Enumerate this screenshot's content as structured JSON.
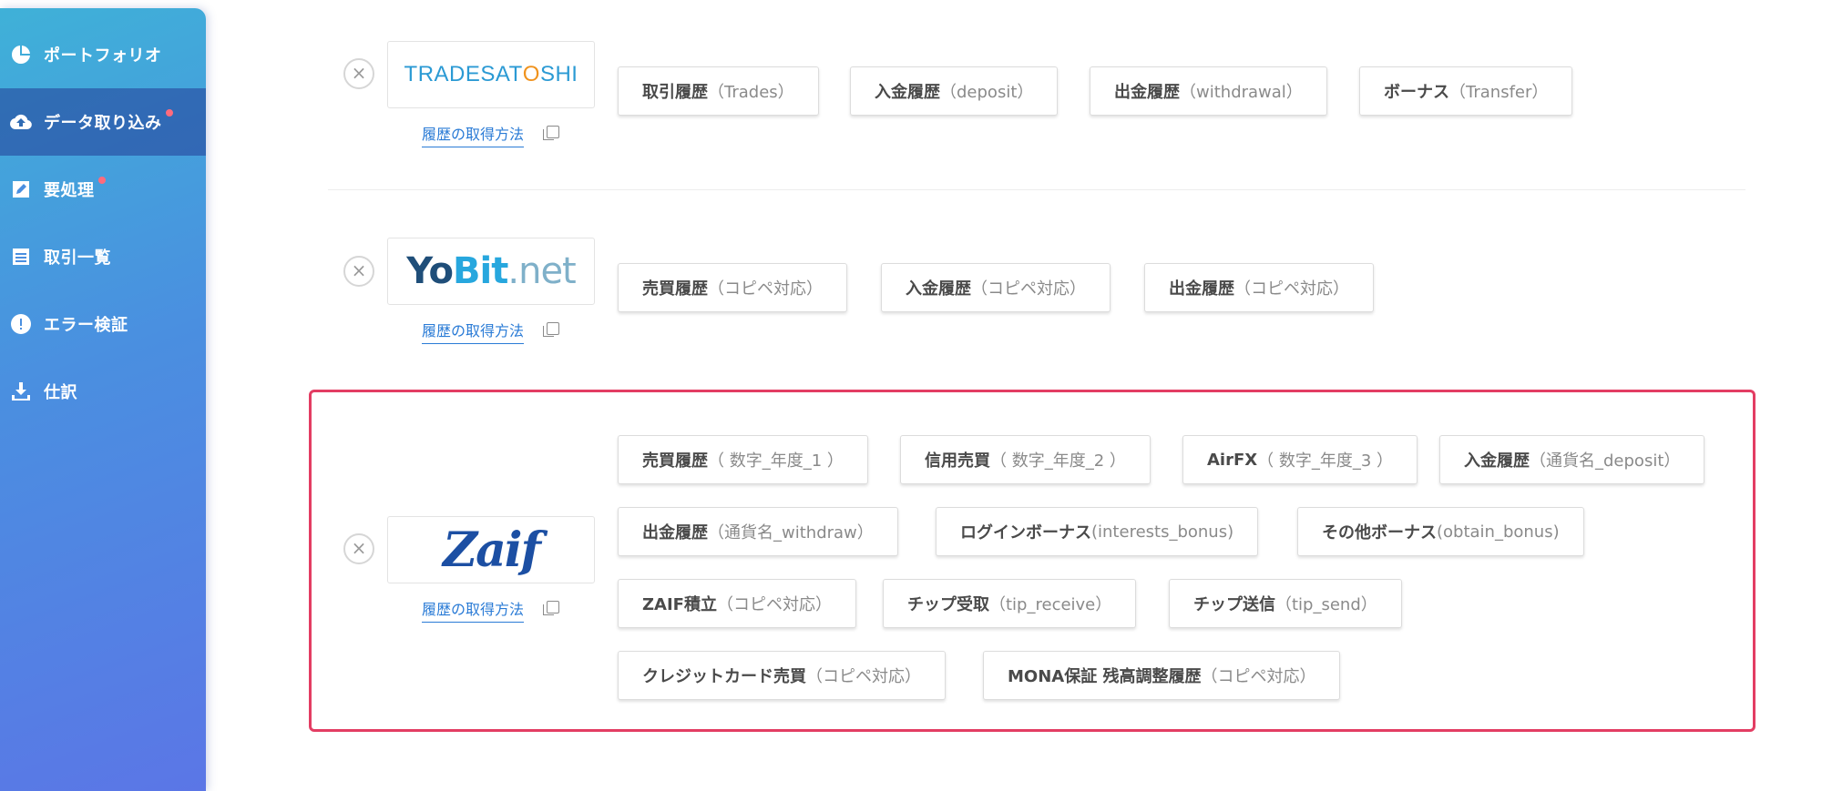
{
  "sidebar": {
    "items": [
      {
        "label": "ポートフォリオ",
        "icon": "pie-chart-icon",
        "active": false,
        "dot": false
      },
      {
        "label": "データ取り込み",
        "icon": "cloud-upload-icon",
        "active": true,
        "dot": true
      },
      {
        "label": "要処理",
        "icon": "edit-icon",
        "active": false,
        "dot": true
      },
      {
        "label": "取引一覧",
        "icon": "list-icon",
        "active": false,
        "dot": false
      },
      {
        "label": "エラー検証",
        "icon": "alert-icon",
        "active": false,
        "dot": false
      },
      {
        "label": "仕訳",
        "icon": "download-icon",
        "active": false,
        "dot": false
      }
    ],
    "dot_color": "#ff6b7d"
  },
  "howto_label": "履歴の取得方法",
  "remove_symbol": "×",
  "exchanges": [
    {
      "name": "tradesatoshi",
      "logo": {
        "part1": "TRADESAT",
        "part2": "O",
        "part3": "SHI"
      },
      "buttons": [
        {
          "main": "取引履歴",
          "sub": "（Trades）"
        },
        {
          "main": "入金履歴",
          "sub": "（deposit）"
        },
        {
          "main": "出金履歴",
          "sub": "（withdrawal）"
        },
        {
          "main": "ボーナス",
          "sub": "（Transfer）"
        }
      ]
    },
    {
      "name": "yobit",
      "logo": {
        "part1": "Yo",
        "part2": "Bit",
        "part3": ".net"
      },
      "buttons": [
        {
          "main": "売買履歴",
          "sub": "（コピペ対応）"
        },
        {
          "main": "入金履歴",
          "sub": "（コピペ対応）"
        },
        {
          "main": "出金履歴",
          "sub": "（コピペ対応）"
        }
      ]
    },
    {
      "name": "zaif",
      "logo": {
        "text": "Zaif"
      },
      "highlight_color": "#e33d63",
      "buttons": [
        {
          "main": "売買履歴",
          "sub": "（ 数字_年度_1 ）"
        },
        {
          "main": "信用売買",
          "sub": "（ 数字_年度_2 ）"
        },
        {
          "main": "AirFX",
          "sub": "（ 数字_年度_3 ）"
        },
        {
          "main": "入金履歴",
          "sub": "（通貨名_deposit）"
        },
        {
          "main": "出金履歴",
          "sub": "（通貨名_withdraw）"
        },
        {
          "main": "ログインボーナス",
          "sub": " (interests_bonus)"
        },
        {
          "main": "その他ボーナス",
          "sub": " (obtain_bonus)"
        },
        {
          "main": "ZAIF積立",
          "sub": "（コピペ対応）"
        },
        {
          "main": "チップ受取",
          "sub": "（tip_receive）"
        },
        {
          "main": "チップ送信",
          "sub": "（tip_send）"
        },
        {
          "main": "クレジットカード売買",
          "sub": "（コピペ対応）"
        },
        {
          "main": "MONA保証 残高調整履歴",
          "sub": "（コピペ対応）"
        }
      ]
    }
  ]
}
